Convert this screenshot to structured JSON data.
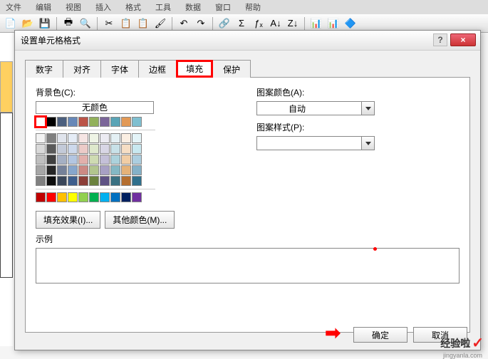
{
  "menu": {
    "items": [
      "文件",
      "编辑",
      "视图",
      "插入",
      "格式",
      "工具",
      "数据",
      "窗口",
      "帮助"
    ]
  },
  "toolbar": {
    "icons": [
      "📄",
      "📂",
      "💾",
      "🖶",
      "🔍",
      "✂",
      "📋",
      "📋",
      "🖌",
      "↶",
      "↷",
      "🔗",
      "Σ",
      "ƒₓ",
      "A↓",
      "Z↓",
      "📊",
      "📊",
      "🔷"
    ]
  },
  "dialog": {
    "title": "设置单元格格式",
    "help": "?",
    "close": "×",
    "tabs": [
      "数字",
      "对齐",
      "字体",
      "边框",
      "填充",
      "保护"
    ],
    "activeTab": 4,
    "bgColorLabel": "背景色(C):",
    "noColor": "无颜色",
    "fillEffects": "填充效果(I)...",
    "moreColors": "其他颜色(M)...",
    "patternColorLabel": "图案颜色(A):",
    "patternColorValue": "自动",
    "patternStyleLabel": "图案样式(P):",
    "patternStyleValue": "",
    "exampleLabel": "示例",
    "ok": "确定",
    "cancel": "取消"
  },
  "colors": {
    "row1": [
      "#ffffff",
      "#000000",
      "#4b5f7e",
      "#6788b8",
      "#bb5448",
      "#92b15b",
      "#7b6699",
      "#5aa4b6",
      "#e29956",
      "#7fbfd0"
    ],
    "row2": [
      "#f2f2f2",
      "#7f7f7f",
      "#e0e4ec",
      "#e5ecf6",
      "#f6e5e4",
      "#eff4e6",
      "#ecebf2",
      "#e4f0f4",
      "#fbefe3",
      "#e4f4f8"
    ],
    "row3": [
      "#d9d9d9",
      "#595959",
      "#c3cad8",
      "#cdd9ec",
      "#eccbc8",
      "#dee8cc",
      "#d8d6e5",
      "#c8e1e8",
      "#f6dec4",
      "#c8e8f0"
    ],
    "row4": [
      "#bfbfbf",
      "#404040",
      "#a5b0c4",
      "#b3c6e2",
      "#e2b0ac",
      "#cedbb2",
      "#c4c0d8",
      "#acd2dc",
      "#f1cda5",
      "#accee0"
    ],
    "row5": [
      "#a6a6a6",
      "#262626",
      "#758199",
      "#87a6cc",
      "#cc8984",
      "#b2c58e",
      "#a7a0c4",
      "#84b8c4",
      "#e5b279",
      "#84b1c8"
    ],
    "row6": [
      "#808080",
      "#0d0d0d",
      "#3a4659",
      "#3e5e8c",
      "#8c3e38",
      "#6b823e",
      "#5e5284",
      "#3a7182",
      "#b56e2f",
      "#2f6f8c"
    ],
    "standard": [
      "#c00000",
      "#ff0000",
      "#ffc000",
      "#ffff00",
      "#92d050",
      "#00b050",
      "#00b0f0",
      "#0070c0",
      "#002060",
      "#7030a0"
    ]
  },
  "watermark": {
    "text": "经验啦",
    "url": "jingyanla.com"
  }
}
